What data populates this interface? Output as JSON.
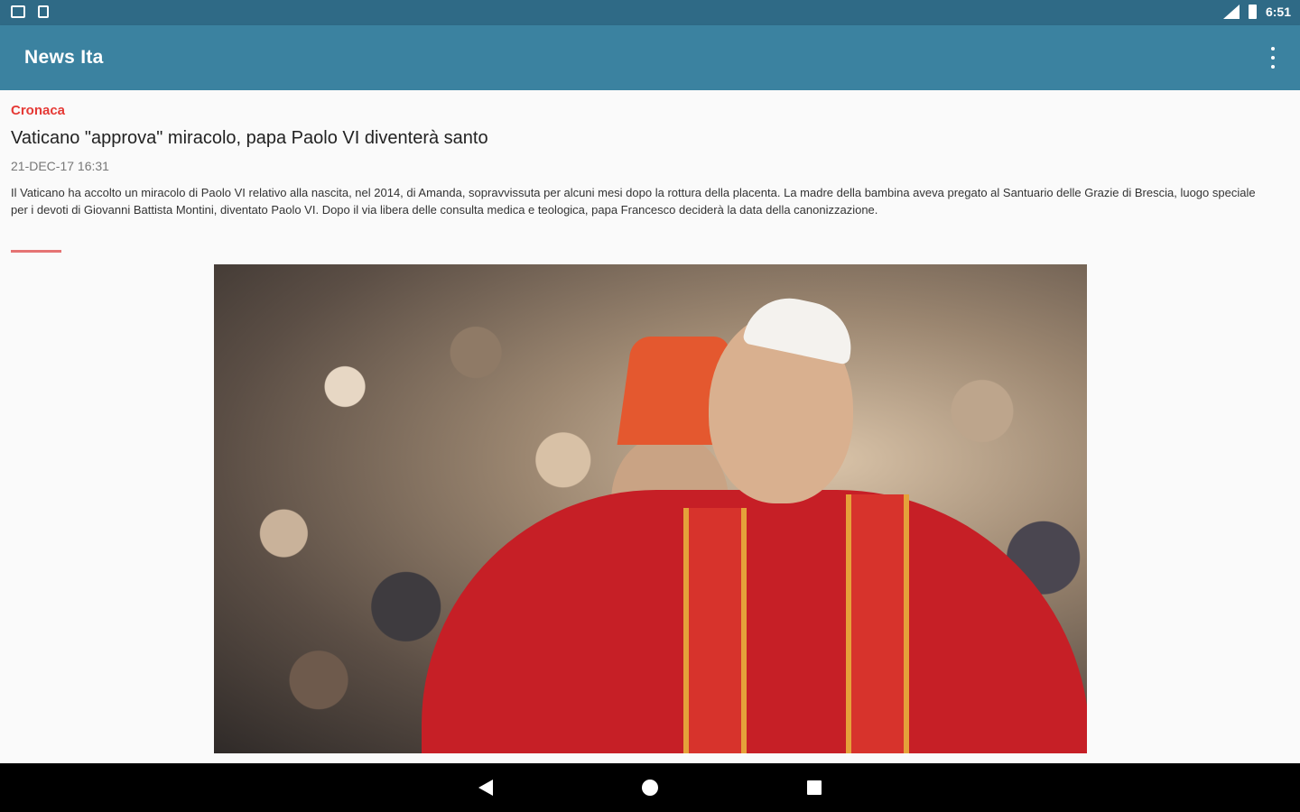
{
  "status_bar": {
    "time": "6:51",
    "icons": [
      "keyboard-icon",
      "sim-icon",
      "signal-icon",
      "battery-icon"
    ]
  },
  "app_bar": {
    "title": "News Ita",
    "menu_icon": "overflow-menu-icon"
  },
  "article": {
    "category": "Cronaca",
    "headline": "Vaticano \"approva\" miracolo, papa Paolo VI diventerà santo",
    "date": "21-DEC-17 16:31",
    "summary": "Il Vaticano ha accolto un miracolo di Paolo VI relativo alla nascita, nel 2014, di Amanda, sopravvissuta per alcuni mesi dopo la rottura della placenta. La madre della bambina aveva pregato al Santuario delle Grazie di Brescia, luogo speciale per i devoti di Giovanni Battista Montini, diventato Paolo VI. Dopo il via libera delle consulta medica e teologica, papa Francesco deciderà la data della canonizzazione.",
    "category_color": "#e53935"
  },
  "colors": {
    "status_bar": "#2f6a86",
    "app_bar": "#3b82a0",
    "accent": "#e53935"
  },
  "nav_bar": {
    "buttons": [
      "back-icon",
      "home-icon",
      "recents-icon"
    ]
  }
}
